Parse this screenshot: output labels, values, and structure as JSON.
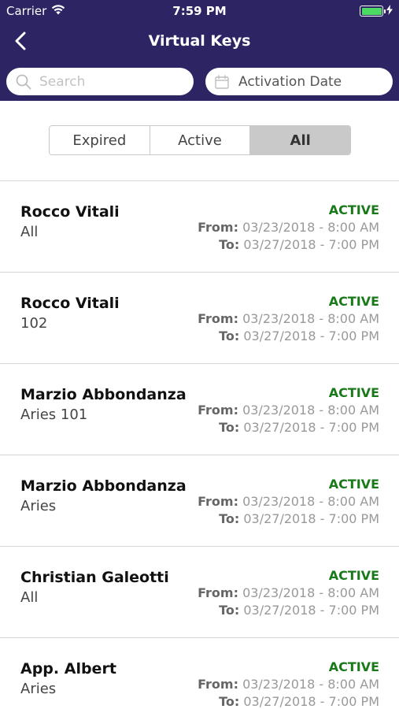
{
  "status_bar": {
    "carrier": "Carrier",
    "time": "7:59 PM",
    "battery_level": 1.0
  },
  "nav": {
    "title": "Virtual Keys"
  },
  "filters": {
    "search_placeholder": "Search",
    "date_label": "Activation Date"
  },
  "segments": {
    "expired": "Expired",
    "active": "Active",
    "all": "All",
    "selected": "All"
  },
  "labels": {
    "from": "From:",
    "to": "To:"
  },
  "keys": [
    {
      "name": "Rocco Vitali",
      "sub": "All",
      "status": "ACTIVE",
      "from": "03/23/2018 - 8:00 AM",
      "to": "03/27/2018 - 7:00 PM"
    },
    {
      "name": "Rocco Vitali",
      "sub": "102",
      "status": "ACTIVE",
      "from": "03/23/2018 - 8:00 AM",
      "to": "03/27/2018 - 7:00 PM"
    },
    {
      "name": "Marzio Abbondanza",
      "sub": "Aries 101",
      "status": "ACTIVE",
      "from": "03/23/2018 - 8:00 AM",
      "to": "03/27/2018 - 7:00 PM"
    },
    {
      "name": "Marzio Abbondanza",
      "sub": "Aries",
      "status": "ACTIVE",
      "from": "03/23/2018 - 8:00 AM",
      "to": "03/27/2018 - 7:00 PM"
    },
    {
      "name": "Christian Galeotti",
      "sub": "All",
      "status": "ACTIVE",
      "from": "03/23/2018 - 8:00 AM",
      "to": "03/27/2018 - 7:00 PM"
    },
    {
      "name": "App. Albert",
      "sub": "Aries",
      "status": "ACTIVE",
      "from": "03/23/2018 - 8:00 AM",
      "to": "03/27/2018 - 7:00 PM"
    }
  ],
  "colors": {
    "header": "#2d2563",
    "active_status": "#1a7a1a",
    "segment_selected": "#c9c9c9"
  }
}
